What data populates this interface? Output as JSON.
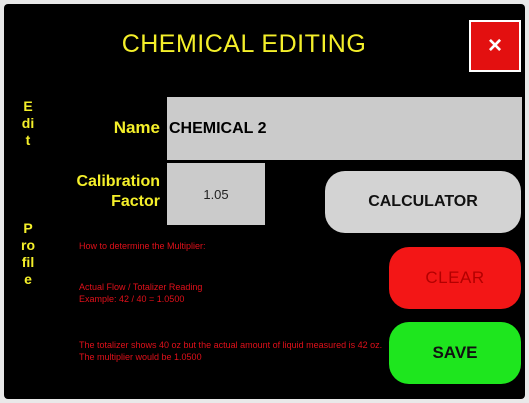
{
  "header": {
    "title": "CHEMICAL EDITING",
    "close_label": "×"
  },
  "sidebar": {
    "label_top": "Edit",
    "label_bottom": "Profile"
  },
  "form": {
    "name_label": "Name",
    "name_value": "CHEMICAL 2",
    "calibration_label_line1": "Calibration",
    "calibration_label_line2": "Factor",
    "calibration_value": "1.05"
  },
  "buttons": {
    "calculator": "CALCULATOR",
    "clear": "CLEAR",
    "save": "SAVE"
  },
  "help": {
    "line1": "How to determine the Multiplier:",
    "line2": "Actual Flow / Totalizer Reading",
    "line3": "Example:  42 / 40 = 1.0500",
    "line4": "The totalizer shows 40 oz but the actual amount of liquid measured is 42 oz.  The multiplier would be 1.0500"
  },
  "colors": {
    "background": "#000000",
    "accent_yellow": "#f4ef2a",
    "close_red": "#e31010",
    "clear_red": "#f31616",
    "save_green": "#1ee61e",
    "help_text_red": "#e0101a",
    "field_gray": "#cbcbcb"
  }
}
